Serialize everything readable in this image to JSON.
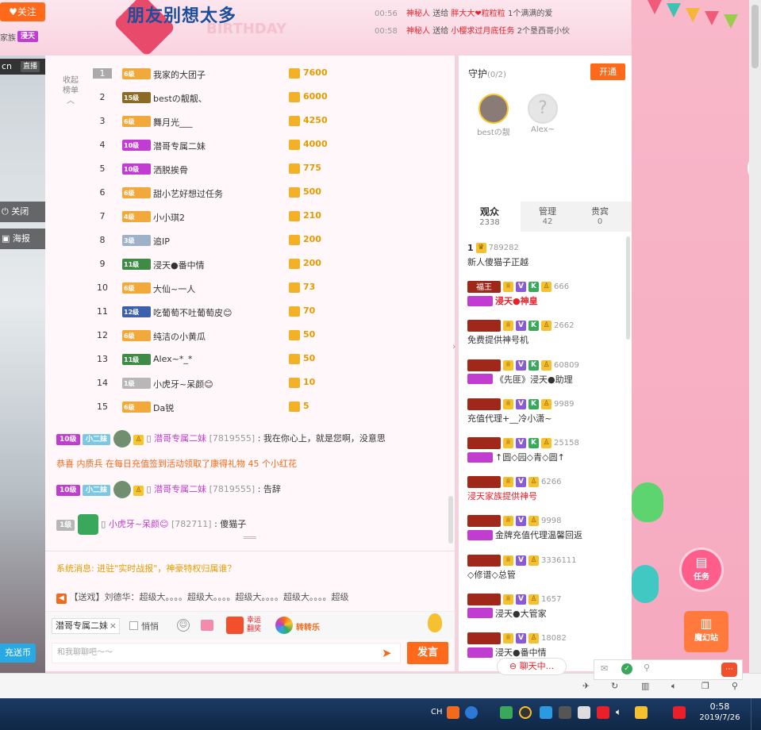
{
  "top": {
    "follow_label": "关注",
    "family_label": "家族",
    "family_badge": "浸天",
    "banner_title": "朋友别想太多",
    "banner_sub": "BIRTHDAY",
    "gift_logs": [
      {
        "time": "00:56",
        "sender": "神秘人",
        "verb": "送给",
        "receiver": "胖大大❤粒粒粒",
        "gift": "1个满满的爱"
      },
      {
        "time": "00:58",
        "sender": "神秘人",
        "verb": "送给",
        "receiver": "小樱求过月底任务",
        "gift": "2个垦西哥小伙"
      }
    ]
  },
  "left": {
    "cn_label": "cn",
    "live_label": "直播",
    "close_label": "关闭",
    "poster_label": "海报",
    "recharge_label": "充送币"
  },
  "rank": {
    "collapse_label": "收起\n榜单",
    "rows": [
      {
        "rank": "1",
        "level": "6级",
        "name": "我家的大团子",
        "value": "7600",
        "badge_color": "#f2a93b"
      },
      {
        "rank": "2",
        "level": "15级",
        "name": "bestの靓靓、",
        "value": "6000",
        "badge_color": "#8a6a24"
      },
      {
        "rank": "3",
        "level": "6级",
        "name": "舞月光___",
        "value": "4250",
        "badge_color": "#f2a93b"
      },
      {
        "rank": "4",
        "level": "10级",
        "name": "潜哥专属二妹",
        "value": "4000",
        "badge_color": "#c13cd1"
      },
      {
        "rank": "5",
        "level": "10级",
        "name": "洒脱挨骨",
        "value": "775",
        "badge_color": "#c13cd1"
      },
      {
        "rank": "6",
        "level": "6级",
        "name": "甜小艺好想过任务",
        "value": "500",
        "badge_color": "#f2a93b"
      },
      {
        "rank": "7",
        "level": "4级",
        "name": "小小琪2",
        "value": "210",
        "badge_color": "#f2a93b"
      },
      {
        "rank": "8",
        "level": "3级",
        "name": "追IP",
        "value": "200",
        "badge_color": "#9fb1c6"
      },
      {
        "rank": "9",
        "level": "11级",
        "name": "浸天●番中情",
        "value": "200",
        "badge_color": "#3f8a45"
      },
      {
        "rank": "10",
        "level": "6级",
        "name": "大仙~一人",
        "value": "73",
        "badge_color": "#f2a93b"
      },
      {
        "rank": "11",
        "level": "12级",
        "name": "吃葡萄不吐葡萄皮😊",
        "value": "70",
        "badge_color": "#3b5fa8"
      },
      {
        "rank": "12",
        "level": "6级",
        "name": "纯洁の小黄瓜",
        "value": "50",
        "badge_color": "#f2a93b"
      },
      {
        "rank": "13",
        "level": "11级",
        "name": "Alex~*_*",
        "value": "50",
        "badge_color": "#3f8a45"
      },
      {
        "rank": "14",
        "level": "1级",
        "name": "小虎牙~呆颜😊",
        "value": "10",
        "badge_color": "#b7b7b7"
      },
      {
        "rank": "15",
        "level": "6级",
        "name": "Da锐",
        "value": "5",
        "badge_color": "#f2a93b"
      }
    ]
  },
  "chat": {
    "msgs": [
      {
        "level": "10级",
        "tag": "小二妹",
        "name": "潜哥专属二妹",
        "id": "[7819555]",
        "text": "我在你心上，就是您啊，没意思"
      },
      {
        "notice": "恭喜 内质兵 在每日充值签到活动领取了康得礼物 45 个小红花"
      },
      {
        "level": "10级",
        "tag": "小二妹",
        "name": "潜哥专属二妹",
        "id": "[7819555]",
        "text": "告辞"
      },
      {
        "level": "1级",
        "name": "小虎牙~呆颜😊",
        "id": "[782711]",
        "text": "傻猫子"
      }
    ],
    "system_msg": "系统消息: 进驻\"实时战报\"，神豪特权归属谁？",
    "broadcast": "【送戏】刘德华：超级大。。。。超级大。。。。超级大。。。。超级大。。。。超级",
    "target_user": "潜哥专属二妹",
    "whisper_label": "悄悄",
    "lucky_label": "幸运\n翻奖",
    "spin_label": "转转乐",
    "input_placeholder": "和我聊聊吧～～",
    "send_label": "发言"
  },
  "guard": {
    "title": "守护",
    "count": "(0/2)",
    "open_label": "开通",
    "members": [
      {
        "name": "bestの靓"
      },
      {
        "name": "Alex~"
      }
    ]
  },
  "tabs": [
    {
      "label": "观众",
      "count": "2338"
    },
    {
      "label": "管理",
      "count": "42"
    },
    {
      "label": "贵宾",
      "count": "0"
    }
  ],
  "audience": [
    {
      "rank": "1",
      "score": "789282",
      "name": "新人傻猫子正越",
      "has_badge": false,
      "flags": "",
      "name_color": "#333"
    },
    {
      "title": "福王",
      "score": "666",
      "name": "浸天●神皇",
      "has_badge": true,
      "flags": "VK",
      "name_color": "#e8202a",
      "bold": true
    },
    {
      "title": "",
      "score": "2662",
      "name": "免费提供神号机",
      "has_badge": false,
      "flags": "VK",
      "name_color": "#333"
    },
    {
      "title": "",
      "score": "60809",
      "name": "《先匪》浸天●助理",
      "has_badge": true,
      "flags": "VK",
      "name_color": "#333"
    },
    {
      "title": "",
      "score": "9989",
      "name": "充值代理+__冷小潇~",
      "has_badge": false,
      "flags": "VK",
      "name_color": "#333"
    },
    {
      "title": "",
      "score": "25158",
      "name": "↑圆◇园◇青◇圆↑",
      "has_badge": true,
      "flags": "VK",
      "name_color": "#333"
    },
    {
      "title": "",
      "score": "6266",
      "name": "浸天家族提供神号",
      "has_badge": false,
      "flags": "V",
      "name_color": "#e8202a"
    },
    {
      "title": "",
      "score": "9998",
      "name": "金牌充值代理温馨回返",
      "has_badge": true,
      "flags": "V",
      "name_color": "#333"
    },
    {
      "title": "",
      "score": "3336111",
      "name": "◇修谱◇总管",
      "has_badge": false,
      "flags": "V",
      "name_color": "#333"
    },
    {
      "title": "",
      "score": "1657",
      "name": "浸天●大管家",
      "has_badge": true,
      "flags": "V",
      "name_color": "#333"
    },
    {
      "title": "",
      "score": "18082",
      "name": "浸天●番中情",
      "has_badge": true,
      "flags": "V",
      "name_color": "#333"
    }
  ],
  "deco": {
    "task_label": "任务",
    "station_label": "魔幻站"
  },
  "bottom": {
    "chat_status": "聊天中..."
  },
  "taskbar": {
    "lang": "CH",
    "time": "0:58",
    "date": "2019/7/26"
  }
}
